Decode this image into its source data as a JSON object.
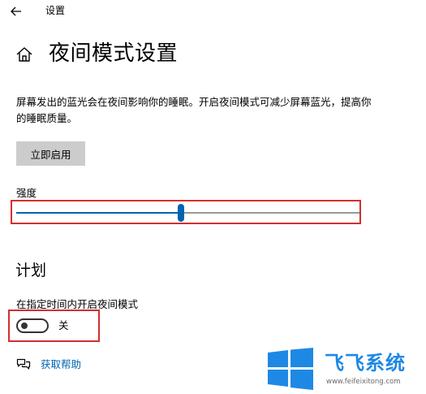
{
  "window": {
    "title": "设置"
  },
  "header": {
    "page_title": "夜间模式设置"
  },
  "main": {
    "description": "屏幕发出的蓝光会在夜间影响你的睡眠。开启夜间模式可减少屏幕蓝光，提高你的睡眠质量。",
    "enable_button_label": "立即启用",
    "strength": {
      "label": "强度",
      "value_fraction": 0.48
    },
    "schedule": {
      "heading": "计划",
      "toggle_label": "在指定时间内开启夜间模式",
      "toggle_state": "关",
      "toggle_on": false
    },
    "help": {
      "link_label": "获取帮助"
    }
  },
  "watermark": {
    "text": "飞飞系统",
    "url": "www.feifeixitong.com"
  },
  "colors": {
    "accent": "#0063b1",
    "highlight_border": "#d32f2f",
    "button_bg": "#cccccc",
    "watermark_blue": "#1e88e5"
  },
  "icons": {
    "back": "back-arrow-icon",
    "home": "home-icon",
    "help": "chat-bubbles-icon",
    "watermark_logo": "windows-logo-icon"
  }
}
